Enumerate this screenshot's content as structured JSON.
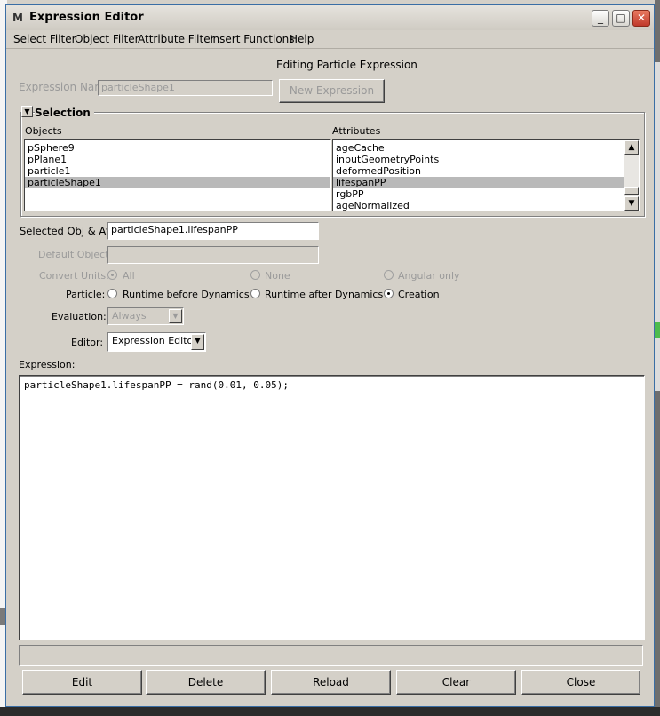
{
  "window": {
    "title": "Expression Editor"
  },
  "menu": [
    "Select Filter",
    "Object Filter",
    "Attribute Filter",
    "Insert Functions",
    "Help"
  ],
  "header": {
    "mode_text": "Editing Particle Expression"
  },
  "expression_name": {
    "label": "Expression Name",
    "value": "particleShape1",
    "new_button": "New Expression"
  },
  "selection": {
    "title": "Selection",
    "objects_label": "Objects",
    "attributes_label": "Attributes",
    "objects": [
      "pSphere9",
      "pPlane1",
      "particle1",
      "particleShape1"
    ],
    "selected_object": "particleShape1",
    "attributes": [
      "ageCache",
      "inputGeometryPoints",
      "deformedPosition",
      "lifespanPP",
      "rgbPP",
      "ageNormalized"
    ],
    "selected_attribute": "lifespanPP"
  },
  "selected_obj_attr": {
    "label": "Selected Obj & Attr",
    "value": "particleShape1.lifespanPP"
  },
  "default_object": {
    "label": "Default Object",
    "value": ""
  },
  "convert_units": {
    "label": "Convert Units:",
    "options": [
      "All",
      "None",
      "Angular only"
    ],
    "selected": "All"
  },
  "particle": {
    "label": "Particle:",
    "options": [
      "Runtime before Dynamics",
      "Runtime after Dynamics",
      "Creation"
    ],
    "selected": "Creation"
  },
  "evaluation": {
    "label": "Evaluation:",
    "value": "Always"
  },
  "editor_type": {
    "label": "Editor:",
    "value": "Expression Editor"
  },
  "expression": {
    "label": "Expression:",
    "text": "particleShape1.lifespanPP = rand(0.01, 0.05);"
  },
  "buttons": {
    "edit": "Edit",
    "delete": "Delete",
    "reload": "Reload",
    "clear": "Clear",
    "close": "Close"
  },
  "colors": {
    "selection_highlight": "#b9b9b9",
    "window_bg": "#d4d0c8"
  }
}
